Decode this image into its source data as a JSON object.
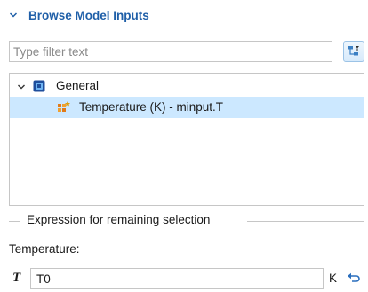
{
  "section": {
    "title": "Browse Model Inputs",
    "icon": "chevron-down-icon"
  },
  "filter": {
    "placeholder": "Type filter text",
    "value": "",
    "button_icon": "filter-tree-icon"
  },
  "tree": {
    "items": [
      {
        "label": "General",
        "icon": "node-group-icon",
        "expanded": true
      },
      {
        "label": "Temperature (K) - minput.T",
        "icon": "model-input-icon",
        "selected": true
      }
    ]
  },
  "expression": {
    "group_title": "Expression for remaining selection",
    "field_caption": "Temperature:",
    "symbol": "T",
    "value": "T0",
    "unit": "K",
    "reset_icon": "reset-arrow-icon"
  },
  "colors": {
    "accent": "#1f5fa8",
    "selection": "#cce8ff",
    "border": "#c6c6c6"
  }
}
